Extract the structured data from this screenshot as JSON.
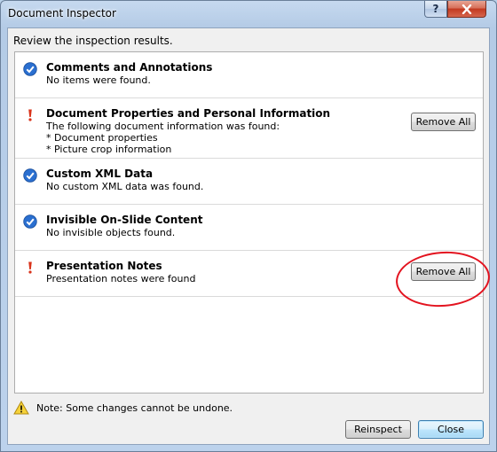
{
  "window": {
    "title": "Document Inspector",
    "help_label": "?",
    "close_label": "×"
  },
  "intro_text": "Review the inspection results.",
  "results": [
    {
      "status": "ok",
      "icon": "checkmark-icon",
      "title": "Comments and Annotations",
      "description": "No items were found."
    },
    {
      "status": "warning",
      "icon": "exclamation-icon",
      "title": "Document Properties and Personal Information",
      "description": "The following document information was found:\n* Document properties\n* Picture crop information",
      "button_label": "Remove All"
    },
    {
      "status": "ok",
      "icon": "checkmark-icon",
      "title": "Custom XML Data",
      "description": "No custom XML data was found."
    },
    {
      "status": "ok",
      "icon": "checkmark-icon",
      "title": "Invisible On-Slide Content",
      "description": "No invisible objects found."
    },
    {
      "status": "warning",
      "icon": "exclamation-icon",
      "title": "Presentation Notes",
      "description": "Presentation notes were found",
      "button_label": "Remove All"
    }
  ],
  "footer": {
    "note": "Note: Some changes cannot be undone.",
    "reinspect_label": "Reinspect",
    "close_label": "Close"
  },
  "colors": {
    "highlight_oval": "#e3131f",
    "check_blue": "#2a6fd0",
    "warning_red": "#d9331b"
  }
}
